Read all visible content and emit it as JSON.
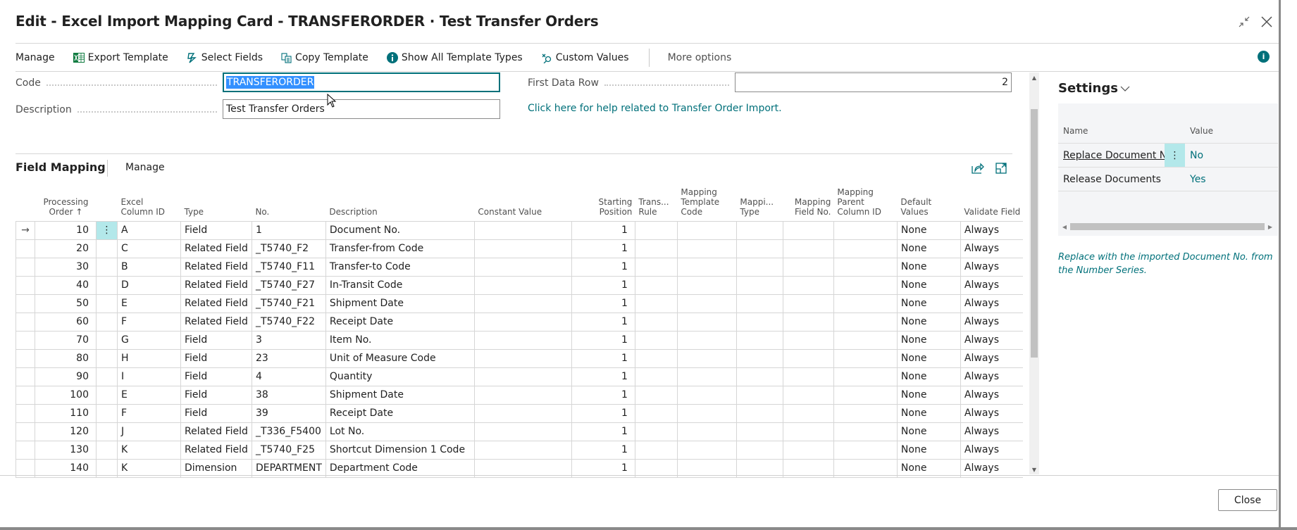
{
  "window": {
    "title": "Edit - Excel Import Mapping Card - TRANSFERORDER · Test Transfer Orders",
    "collapse_icon": "collapse-icon",
    "close_icon": "close-icon"
  },
  "toolbar": {
    "items": [
      {
        "label": "Manage",
        "icon": null
      },
      {
        "label": "Export Template",
        "icon": "excel-export-icon"
      },
      {
        "label": "Select Fields",
        "icon": "select-fields-icon"
      },
      {
        "label": "Copy Template",
        "icon": "copy-icon"
      },
      {
        "label": "Show All Template Types",
        "icon": "info-icon"
      },
      {
        "label": "Custom Values",
        "icon": "custom-values-icon"
      }
    ],
    "more_options": "More options",
    "info_icon": "info-icon"
  },
  "form": {
    "code_label": "Code",
    "code_value": "TRANSFERORDER",
    "description_label": "Description",
    "description_value": "Test Transfer Orders",
    "first_data_row_label": "First Data Row",
    "first_data_row_value": "2",
    "help_link": "Click here for help related to Transfer Order Import."
  },
  "field_mapping": {
    "title": "Field Mapping",
    "manage": "Manage",
    "columns": [
      {
        "key": "processing_order",
        "label": "Processing\nOrder ↑"
      },
      {
        "key": "excel_column_id",
        "label": "Excel\nColumn ID"
      },
      {
        "key": "type",
        "label": "Type"
      },
      {
        "key": "no",
        "label": "No."
      },
      {
        "key": "description",
        "label": "Description"
      },
      {
        "key": "constant_value",
        "label": "Constant Value"
      },
      {
        "key": "starting_position",
        "label": "Starting\nPosition"
      },
      {
        "key": "trans_rule",
        "label": "Trans...\nRule"
      },
      {
        "key": "mapping_template_code",
        "label": "Mapping\nTemplate\nCode"
      },
      {
        "key": "mapping_type",
        "label": "Mappi...\nType"
      },
      {
        "key": "mapping_field_no",
        "label": "Mapping\nField No."
      },
      {
        "key": "mapping_parent_column_id",
        "label": "Mapping\nParent\nColumn ID"
      },
      {
        "key": "default_values",
        "label": "Default\nValues"
      },
      {
        "key": "validate_field",
        "label": "Validate Field"
      }
    ],
    "rows": [
      {
        "processing_order": "10",
        "excel_column_id": "A",
        "type": "Field",
        "no": "1",
        "description": "Document No.",
        "constant_value": "",
        "starting_position": "1",
        "trans_rule": "",
        "mapping_template_code": "",
        "mapping_type": "",
        "mapping_field_no": "",
        "mapping_parent_column_id": "",
        "default_values": "None",
        "validate_field": "Always",
        "current": true
      },
      {
        "processing_order": "20",
        "excel_column_id": "C",
        "type": "Related Field",
        "no": "_T5740_F2",
        "description": "Transfer-from Code",
        "constant_value": "",
        "starting_position": "1",
        "trans_rule": "",
        "mapping_template_code": "",
        "mapping_type": "",
        "mapping_field_no": "",
        "mapping_parent_column_id": "",
        "default_values": "None",
        "validate_field": "Always"
      },
      {
        "processing_order": "30",
        "excel_column_id": "B",
        "type": "Related Field",
        "no": "_T5740_F11",
        "description": "Transfer-to Code",
        "constant_value": "",
        "starting_position": "1",
        "trans_rule": "",
        "mapping_template_code": "",
        "mapping_type": "",
        "mapping_field_no": "",
        "mapping_parent_column_id": "",
        "default_values": "None",
        "validate_field": "Always"
      },
      {
        "processing_order": "40",
        "excel_column_id": "D",
        "type": "Related Field",
        "no": "_T5740_F27",
        "description": "In-Transit Code",
        "constant_value": "",
        "starting_position": "1",
        "trans_rule": "",
        "mapping_template_code": "",
        "mapping_type": "",
        "mapping_field_no": "",
        "mapping_parent_column_id": "",
        "default_values": "None",
        "validate_field": "Always"
      },
      {
        "processing_order": "50",
        "excel_column_id": "E",
        "type": "Related Field",
        "no": "_T5740_F21",
        "description": "Shipment Date",
        "constant_value": "",
        "starting_position": "1",
        "trans_rule": "",
        "mapping_template_code": "",
        "mapping_type": "",
        "mapping_field_no": "",
        "mapping_parent_column_id": "",
        "default_values": "None",
        "validate_field": "Always"
      },
      {
        "processing_order": "60",
        "excel_column_id": "F",
        "type": "Related Field",
        "no": "_T5740_F22",
        "description": "Receipt Date",
        "constant_value": "",
        "starting_position": "1",
        "trans_rule": "",
        "mapping_template_code": "",
        "mapping_type": "",
        "mapping_field_no": "",
        "mapping_parent_column_id": "",
        "default_values": "None",
        "validate_field": "Always"
      },
      {
        "processing_order": "70",
        "excel_column_id": "G",
        "type": "Field",
        "no": "3",
        "description": "Item No.",
        "constant_value": "",
        "starting_position": "1",
        "trans_rule": "",
        "mapping_template_code": "",
        "mapping_type": "",
        "mapping_field_no": "",
        "mapping_parent_column_id": "",
        "default_values": "None",
        "validate_field": "Always"
      },
      {
        "processing_order": "80",
        "excel_column_id": "H",
        "type": "Field",
        "no": "23",
        "description": "Unit of Measure Code",
        "constant_value": "",
        "starting_position": "1",
        "trans_rule": "",
        "mapping_template_code": "",
        "mapping_type": "",
        "mapping_field_no": "",
        "mapping_parent_column_id": "",
        "default_values": "None",
        "validate_field": "Always"
      },
      {
        "processing_order": "90",
        "excel_column_id": "I",
        "type": "Field",
        "no": "4",
        "description": "Quantity",
        "constant_value": "",
        "starting_position": "1",
        "trans_rule": "",
        "mapping_template_code": "",
        "mapping_type": "",
        "mapping_field_no": "",
        "mapping_parent_column_id": "",
        "default_values": "None",
        "validate_field": "Always"
      },
      {
        "processing_order": "100",
        "excel_column_id": "E",
        "type": "Field",
        "no": "38",
        "description": "Shipment Date",
        "constant_value": "",
        "starting_position": "1",
        "trans_rule": "",
        "mapping_template_code": "",
        "mapping_type": "",
        "mapping_field_no": "",
        "mapping_parent_column_id": "",
        "default_values": "None",
        "validate_field": "Always"
      },
      {
        "processing_order": "110",
        "excel_column_id": "F",
        "type": "Field",
        "no": "39",
        "description": "Receipt Date",
        "constant_value": "",
        "starting_position": "1",
        "trans_rule": "",
        "mapping_template_code": "",
        "mapping_type": "",
        "mapping_field_no": "",
        "mapping_parent_column_id": "",
        "default_values": "None",
        "validate_field": "Always"
      },
      {
        "processing_order": "120",
        "excel_column_id": "J",
        "type": "Related Field",
        "no": "_T336_F5400",
        "description": "Lot No.",
        "constant_value": "",
        "starting_position": "1",
        "trans_rule": "",
        "mapping_template_code": "",
        "mapping_type": "",
        "mapping_field_no": "",
        "mapping_parent_column_id": "",
        "default_values": "None",
        "validate_field": "Always"
      },
      {
        "processing_order": "130",
        "excel_column_id": "K",
        "type": "Related Field",
        "no": "_T5740_F25",
        "description": "Shortcut Dimension 1 Code",
        "constant_value": "",
        "starting_position": "1",
        "trans_rule": "",
        "mapping_template_code": "",
        "mapping_type": "",
        "mapping_field_no": "",
        "mapping_parent_column_id": "",
        "default_values": "None",
        "validate_field": "Always"
      },
      {
        "processing_order": "140",
        "excel_column_id": "K",
        "type": "Dimension",
        "no": "DEPARTMENT",
        "description": "Department Code",
        "constant_value": "",
        "starting_position": "1",
        "trans_rule": "",
        "mapping_template_code": "",
        "mapping_type": "",
        "mapping_field_no": "",
        "mapping_parent_column_id": "",
        "default_values": "None",
        "validate_field": "Always"
      }
    ]
  },
  "settings": {
    "title": "Settings",
    "name_header": "Name",
    "value_header": "Value",
    "rows": [
      {
        "name": "Replace Document No.",
        "value": "No"
      },
      {
        "name": "Release Documents",
        "value": "Yes"
      }
    ],
    "help_text": "Replace with the imported Document No. from the Number Series."
  },
  "footer": {
    "close_label": "Close"
  },
  "colors": {
    "accent": "#00707a",
    "selection": "#3390ff",
    "active_cell": "#b3e8ea"
  }
}
